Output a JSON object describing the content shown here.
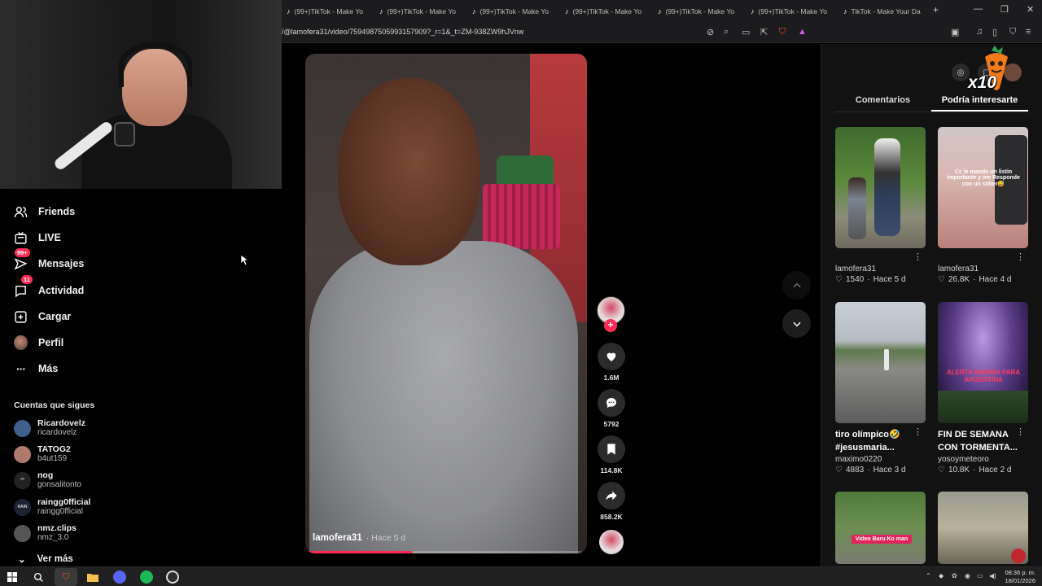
{
  "browser": {
    "tabs": [
      {
        "label": "(99+)TikTok - Make Yo"
      },
      {
        "label": "(99+)TikTok - Make Yo"
      },
      {
        "label": "(99+)TikTok - Make Yo"
      },
      {
        "label": "(99+)TikTok - Make Yo"
      },
      {
        "label": "(99+)TikTok - Make Yo"
      },
      {
        "label": "(99+)TikTok - Make Yo"
      },
      {
        "label": "TikTok - Make Your Da"
      }
    ],
    "new_tab": "+",
    "url": "/@lamofera31/video/7594987505993157909?_r=1&_t=ZM-938ZW9hJVnw"
  },
  "sidebar": {
    "nav": [
      {
        "label": "Friends",
        "icon": "friends-icon"
      },
      {
        "label": "LIVE",
        "icon": "live-icon"
      },
      {
        "label": "Mensajes",
        "icon": "messages-icon",
        "badge": "99+"
      },
      {
        "label": "Actividad",
        "icon": "activity-icon",
        "badge": "11"
      },
      {
        "label": "Cargar",
        "icon": "upload-icon"
      },
      {
        "label": "Perfil",
        "icon": "profile-icon"
      },
      {
        "label": "Más",
        "icon": "more-icon"
      }
    ],
    "following_title": "Cuentas que sigues",
    "following": [
      {
        "name": "Ricardovelz",
        "handle": "ricardovelz",
        "color": "#3d5f8a"
      },
      {
        "name": "TATOG2",
        "handle": "b4ut159",
        "color": "#b07a6a"
      },
      {
        "name": "nog",
        "handle": "gonsalitonto",
        "color": "#222222",
        "avatar_text": "ᵒᵒ"
      },
      {
        "name": "raingg0fficial",
        "handle": "raingg0fficial",
        "color": "#1b2333",
        "avatar_text": "RAIN"
      },
      {
        "name": "nmz.clips",
        "handle": "nmz_3.0",
        "color": "#555555"
      }
    ],
    "see_more": "Ver más"
  },
  "video": {
    "author": "lamofera31",
    "time": "· Hace 5 d",
    "progress": 0.38,
    "likes": "1.6M",
    "comments": "5792",
    "saves": "114.8K",
    "shares": "858.2K"
  },
  "panel": {
    "tabs": [
      "Comentarios",
      "Podría interesarte"
    ],
    "active_tab": 1,
    "overlay_badge": "x10",
    "cards": [
      {
        "title": "",
        "author": "lamofera31",
        "likes": "1540",
        "time": "Hace 5 d",
        "theme": "boy-garden"
      },
      {
        "title": "",
        "author": "lamofera31",
        "likes": "26.8K",
        "time": "Hace 4 d",
        "theme": "selfie",
        "overlay": "Cc le mando un listin importante y me Responde con un stiker😅"
      },
      {
        "title": "tiro olímpico🤣 #jesusmaria...",
        "author": "maximo0220",
        "likes": "4883",
        "time": "Hace 3 d",
        "theme": "field"
      },
      {
        "title": "FIN DE SEMANA CON TORMENTA...",
        "author": "yosoymeteoro",
        "likes": "10.8K",
        "time": "Hace 2 d",
        "theme": "storm",
        "overlay": "ALERTA MÁXIMA PARA ARGENTINA"
      },
      {
        "title": "",
        "author": "",
        "likes": "",
        "time": "",
        "theme": "road",
        "overlay": "Video Baru Ko man"
      },
      {
        "title": "",
        "author": "",
        "likes": "",
        "time": "",
        "theme": "wall"
      }
    ]
  },
  "taskbar": {
    "time": "08:36 p. m.",
    "date": "18/01/2026"
  },
  "colors": {
    "accent": "#fe2c55",
    "background": "#000000",
    "panel": "#121212"
  }
}
